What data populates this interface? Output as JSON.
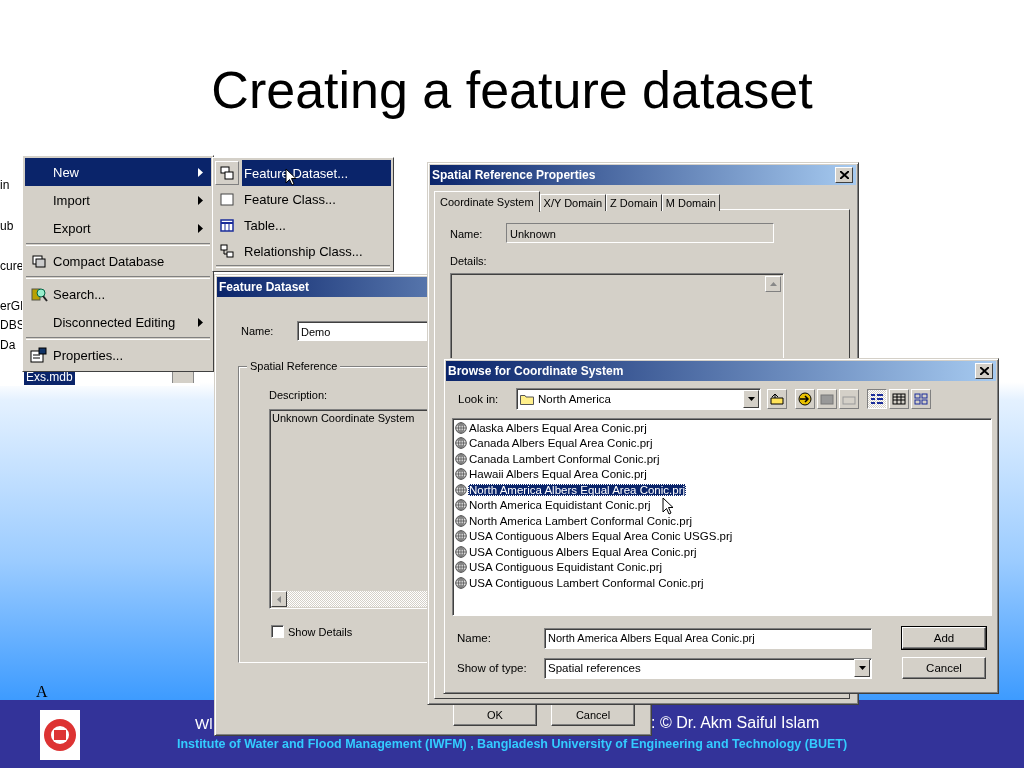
{
  "slide": {
    "title": "Creating a feature dataset",
    "corner_mark": "A"
  },
  "catalog_tree": {
    "items": [
      {
        "label": "in",
        "selected": false
      },
      {
        "label": "ub",
        "selected": false
      },
      {
        "label": "cure",
        "selected": false
      },
      {
        "label": "erGI",
        "selected": false
      },
      {
        "label": "DBS",
        "selected": false
      },
      {
        "label": "Da",
        "selected": false
      },
      {
        "label": "Exs.mdb",
        "selected": true
      }
    ]
  },
  "context_menu": {
    "items": [
      {
        "kind": "item",
        "label": "New",
        "submenu": true,
        "selected": true
      },
      {
        "kind": "item",
        "label": "Import",
        "submenu": true,
        "selected": false
      },
      {
        "kind": "item",
        "label": "Export",
        "submenu": true,
        "selected": false
      },
      {
        "kind": "separator"
      },
      {
        "kind": "item",
        "label": "Compact Database",
        "submenu": false,
        "selected": false
      },
      {
        "kind": "separator"
      },
      {
        "kind": "item",
        "label": "Search...",
        "submenu": false,
        "selected": false
      },
      {
        "kind": "item",
        "label": "Disconnected Editing",
        "submenu": true,
        "selected": false
      },
      {
        "kind": "separator"
      },
      {
        "kind": "item",
        "label": "Properties...",
        "submenu": false,
        "selected": false
      }
    ]
  },
  "submenu": {
    "items": [
      {
        "kind": "item",
        "label": "Feature Dataset...",
        "selected": true
      },
      {
        "kind": "item",
        "label": "Feature Class...",
        "selected": false
      },
      {
        "kind": "item",
        "label": "Table...",
        "selected": false
      },
      {
        "kind": "item",
        "label": "Relationship Class...",
        "selected": false
      },
      {
        "kind": "separator"
      }
    ]
  },
  "feature_dataset_dialog": {
    "title": "Feature Dataset",
    "name_label": "Name:",
    "name_value": "Demo",
    "group_label": "Spatial Reference",
    "description_label": "Description:",
    "description": "Unknown Coordinate System",
    "show_details": {
      "label": "Show Details",
      "checked": false
    },
    "buttons": [
      "OK",
      "Cancel"
    ]
  },
  "spatial_reference_dialog": {
    "title": "Spatial Reference Properties",
    "tabs": [
      {
        "label": "Coordinate System",
        "selected": true
      },
      {
        "label": "X/Y Domain",
        "selected": false
      },
      {
        "label": "Z Domain",
        "selected": false
      },
      {
        "label": "M Domain",
        "selected": false
      }
    ],
    "name_label": "Name:",
    "name_value": "Unknown",
    "details_label": "Details:"
  },
  "browse_dialog": {
    "title": "Browse for Coordinate System",
    "look_in_label": "Look in:",
    "look_in_value": "North America",
    "files": [
      {
        "label": "Alaska Albers Equal Area Conic.prj",
        "selected": false
      },
      {
        "label": "Canada Albers Equal Area Conic.prj",
        "selected": false
      },
      {
        "label": "Canada Lambert Conformal Conic.prj",
        "selected": false
      },
      {
        "label": "Hawaii Albers Equal Area Conic.prj",
        "selected": false
      },
      {
        "label": "North America Albers Equal Area Conic.prj",
        "selected": true
      },
      {
        "label": "North America Equidistant Conic.prj",
        "selected": false
      },
      {
        "label": "North America Lambert Conformal Conic.prj",
        "selected": false
      },
      {
        "label": "USA Contiguous Albers Equal Area Conic USGS.prj",
        "selected": false
      },
      {
        "label": "USA Contiguous Albers Equal Area Conic.prj",
        "selected": false
      },
      {
        "label": "USA Contiguous Equidistant Conic.prj",
        "selected": false
      },
      {
        "label": "USA Contiguous Lambert Conformal Conic.prj",
        "selected": false
      }
    ],
    "name_label": "Name:",
    "name_value": "North America Albers Equal Area Conic.prj",
    "type_label": "Show of type:",
    "type_value": "Spatial references",
    "buttons": [
      "Add",
      "Cancel"
    ]
  },
  "footer": {
    "left_text": "Wl",
    "right_text": ": © Dr. Akm Saiful Islam",
    "institute": "Institute of Water and Flood Management (IWFM) , Bangladesh University of Engineering and Technology (BUET)"
  }
}
